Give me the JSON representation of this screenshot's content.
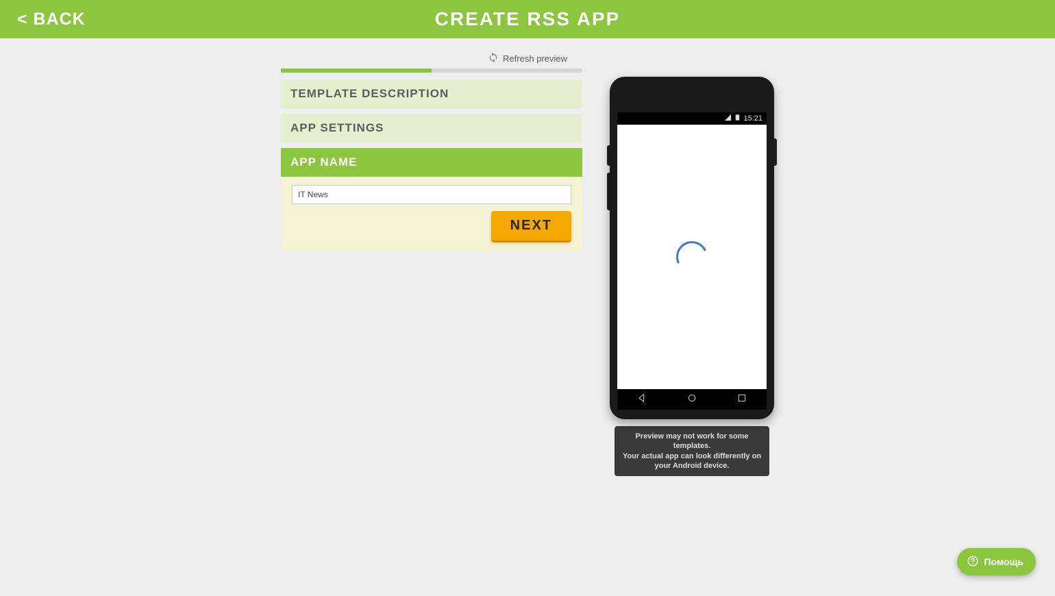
{
  "header": {
    "back_label": "< BACK",
    "title": "CREATE RSS APP"
  },
  "refresh_label": "Refresh preview",
  "progress_percent": 50,
  "sections": {
    "template_desc": "TEMPLATE DESCRIPTION",
    "app_settings": "APP SETTINGS",
    "app_name": "APP NAME"
  },
  "app_name_value": "IT News",
  "next_label": "NEXT",
  "phone": {
    "time": "15:21"
  },
  "preview_note_line1": "Preview may not work for some templates.",
  "preview_note_line2": "Your actual app can look differently on your Android device.",
  "help_label": "Помощь",
  "colors": {
    "primary": "#8cc63f",
    "accent": "#f5a800"
  }
}
